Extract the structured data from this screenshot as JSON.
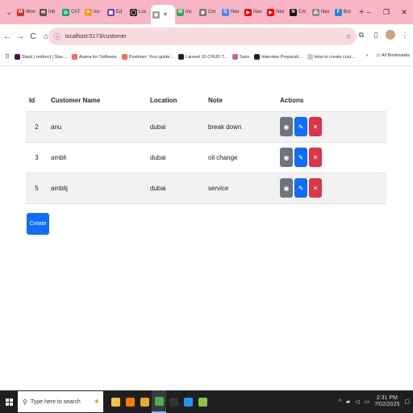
{
  "browser": {
    "tabs": [
      {
        "icon": "gmail-icon",
        "label": "Won",
        "color": "#d93025",
        "glyph": "M"
      },
      {
        "icon": "mail-icon",
        "label": "Inb",
        "color": "#555555",
        "glyph": "✉"
      },
      {
        "icon": "chatgpt-icon",
        "label": "ChT",
        "color": "#10a37f",
        "glyph": "◎"
      },
      {
        "icon": "incognito-icon",
        "label": "Inc",
        "color": "#f0a020",
        "glyph": "●"
      },
      {
        "icon": "tab-icon",
        "label": "Ed",
        "color": "#6f42c1",
        "glyph": "▣"
      },
      {
        "icon": "github-icon",
        "label": "Loc",
        "color": "#222222",
        "glyph": "◯"
      }
    ],
    "active_tab": {
      "icon": "chrome-icon",
      "label": ""
    },
    "tabs_after": [
      {
        "icon": "gmail-icon",
        "label": "mc",
        "color": "#34a853",
        "glyph": "M"
      },
      {
        "icon": "chrome-icon",
        "label": "Cm",
        "color": "#777777",
        "glyph": "◉"
      },
      {
        "icon": "google-icon",
        "label": "Nex",
        "color": "#4285f4",
        "glyph": "G"
      },
      {
        "icon": "youtube-icon",
        "label": "Nex",
        "color": "#ff0000",
        "glyph": "▶"
      },
      {
        "icon": "youtube-icon",
        "label": "Nex",
        "color": "#ff0000",
        "glyph": "▶"
      },
      {
        "icon": "notion-icon",
        "label": "Cm",
        "color": "#111111",
        "glyph": "N"
      },
      {
        "icon": "grid-icon",
        "label": "Nex",
        "color": "#888888",
        "glyph": "⁂"
      },
      {
        "icon": "file-icon",
        "label": "Bot",
        "color": "#1e88e5",
        "glyph": "F"
      }
    ],
    "new_tab": "+",
    "window_controls": {
      "expand": "⌄",
      "minimize": "–",
      "maximize": "❐",
      "close": "✕"
    },
    "nav": {
      "back": "←",
      "forward": "→",
      "reload": "C",
      "home": "⌂"
    },
    "url": "localhost:5173/customer",
    "bookmarks": [
      {
        "label": "Slack | redirect | Slac...",
        "color": "#4a154b"
      },
      {
        "label": "Asana for Software",
        "color": "#f06a6a"
      },
      {
        "label": "Postman: Your guide...",
        "color": "#ff6c37"
      },
      {
        "label": "Laravel 10 CRUD T...",
        "color": "#222222"
      },
      {
        "label": "Sass",
        "color": "#cc6699"
      },
      {
        "label": "Interview Preparati...",
        "color": "#222222"
      },
      {
        "label": "How to create cust...",
        "color": "#cccccc"
      }
    ],
    "bookmarks_right": [
      "»",
      "All Bookmarks"
    ]
  },
  "table": {
    "headers": {
      "id": "Id",
      "name": "Customer Name",
      "location": "Location",
      "note": "Note",
      "actions": "Actions"
    },
    "rows": [
      {
        "id": "2",
        "name": "anu",
        "location": "dubai",
        "note": "break down"
      },
      {
        "id": "3",
        "name": "ambli",
        "location": "dubai",
        "note": "oil change"
      },
      {
        "id": "5",
        "name": "amblij",
        "location": "dubai",
        "note": "service"
      }
    ],
    "action_glyphs": {
      "view": "◉",
      "edit": "✎",
      "delete": "✕"
    }
  },
  "create_label": "Create",
  "taskbar": {
    "search_placeholder": "Type here to search",
    "apps": [
      {
        "icon": "file-explorer-icon",
        "color": "#f4c542"
      },
      {
        "icon": "store-icon",
        "color": "#f57c00"
      },
      {
        "icon": "folder-icon",
        "color": "#e0b030"
      },
      {
        "icon": "chrome-icon",
        "color": "#4caf50"
      },
      {
        "icon": "terminal-icon",
        "color": "#333333"
      },
      {
        "icon": "vscode-icon",
        "color": "#2196f3"
      },
      {
        "icon": "app-icon",
        "color": "#8bc34a"
      }
    ],
    "tray": {
      "chevron": "^",
      "network": "▰",
      "volume": "◁",
      "battery": "▭"
    },
    "time": "2:31 PM",
    "date": "7/02/2025"
  }
}
